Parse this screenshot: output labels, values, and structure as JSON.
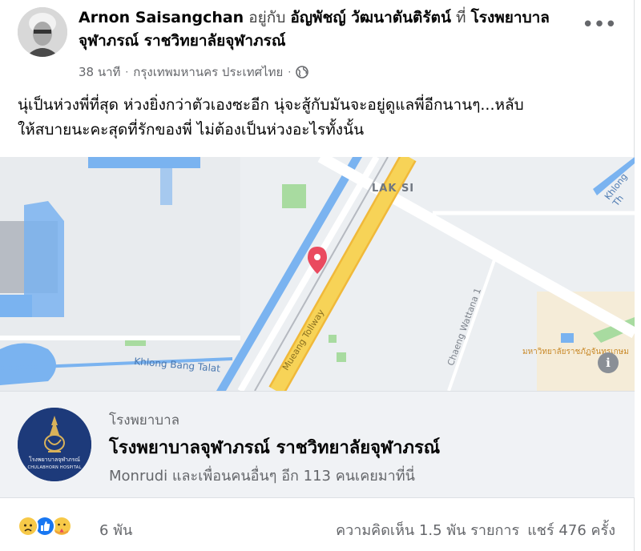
{
  "post": {
    "author": "Arnon Saisangchan",
    "with_word": "อยู่กับ",
    "tagged_person": "อัญพัชญ์ วัฒนาตันติรัตน์",
    "at_word": "ที่",
    "location_name": "โรงพยาบาลจุฬาภรณ์ ราชวิทยาลัยจุฬาภรณ์",
    "time": "38 นาที",
    "place": "กรุงเทพมหานคร ประเทศไทย",
    "separator": "·",
    "more_icon_glyph": "•••",
    "text_line1": "นุ่เป็นห่วงพี่ที่สุด ห่วงยิ่งกว่าตัวเองซะอีก นุ่จะสู้กับมันจะอยู่ดูแลพี่อีกนานๆ...หลับ",
    "text_line2": "ให้สบายนะคะสุดที่รักของพี่ ไม่ต้องเป็นห่วงอะไรทั้งนั้น"
  },
  "map": {
    "labels": {
      "lak_si": "LAK SI",
      "khlong_bang_talat": "Khlong Bang Talat",
      "mueang_tollway": "Mueang Tollway",
      "chaeng_wattana": "Chaeng Wattana 1",
      "khlong_th": "Khlong Th",
      "university": "มหาวิทยาลัยราชภัฏจันทรเกษม"
    },
    "info_icon_glyph": "i",
    "colors": {
      "water": "#7ab3f0",
      "park": "#a8dba0",
      "tollway": "#f7d357",
      "pin": "#ea4a5f"
    }
  },
  "place_card": {
    "category": "โรงพยาบาล",
    "name": "โรงพยาบาลจุฬาภรณ์ ราชวิทยาลัยจุฬาภรณ์",
    "visitors": "Monrudi และเพื่อนคนอื่นๆ อีก 113 คนเคยมาที่นี่",
    "logo_text_thai": "โรงพยาบาลจุฬาภรณ์",
    "logo_text_en": "CHULABHORN HOSPITAL"
  },
  "footer": {
    "reactions": [
      "sad-icon",
      "like-icon",
      "care-icon"
    ],
    "reaction_count": "6 พัน",
    "comments": "ความคิดเห็น 1.5 พัน รายการ",
    "shares": "แชร์ 476 ครั้ง"
  }
}
